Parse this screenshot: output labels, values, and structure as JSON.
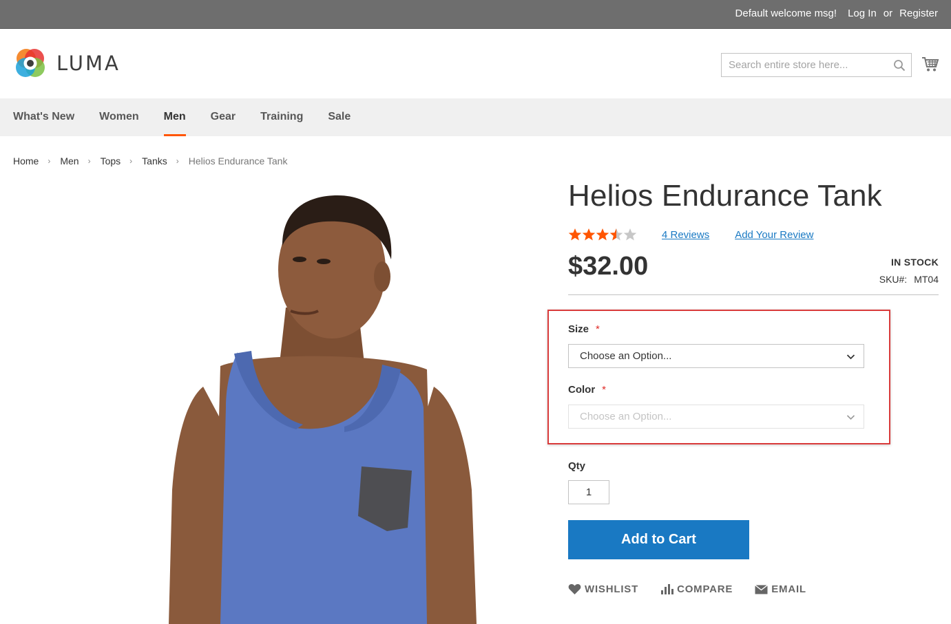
{
  "topbar": {
    "welcome": "Default welcome msg!",
    "login": "Log In",
    "or": "or",
    "register": "Register"
  },
  "header": {
    "logo_text": "LUMA",
    "search_placeholder": "Search entire store here...",
    "search_icon": "search-icon",
    "cart_icon": "cart-icon"
  },
  "nav": {
    "items": [
      {
        "label": "What's New"
      },
      {
        "label": "Women"
      },
      {
        "label": "Men",
        "active": true
      },
      {
        "label": "Gear"
      },
      {
        "label": "Training"
      },
      {
        "label": "Sale"
      }
    ]
  },
  "breadcrumbs": {
    "items": [
      "Home",
      "Men",
      "Tops",
      "Tanks"
    ],
    "current": "Helios Endurance Tank"
  },
  "product": {
    "name": "Helios Endurance Tank",
    "rating_stars": 3.5,
    "rating_max": 5,
    "reviews": "4 Reviews",
    "add_review": "Add Your Review",
    "price": "$32.00",
    "stock": "IN STOCK",
    "sku_label": "SKU#:",
    "sku": "MT04"
  },
  "options": {
    "size_label": "Size",
    "size_value": "Choose an Option...",
    "color_label": "Color",
    "color_value": "Choose an Option...",
    "required_marker": "*"
  },
  "purchase": {
    "qty_label": "Qty",
    "qty_value": "1",
    "add_to_cart": "Add to Cart"
  },
  "actions": {
    "wishlist": "WISHLIST",
    "compare": "COMPARE",
    "email": "EMAIL"
  },
  "colors": {
    "accent": "#1979c3",
    "nav_active_underline": "#ff5501",
    "highlight_border": "#d93a3a",
    "star_filled": "#ff5501",
    "star_empty": "#c7c7c7"
  }
}
